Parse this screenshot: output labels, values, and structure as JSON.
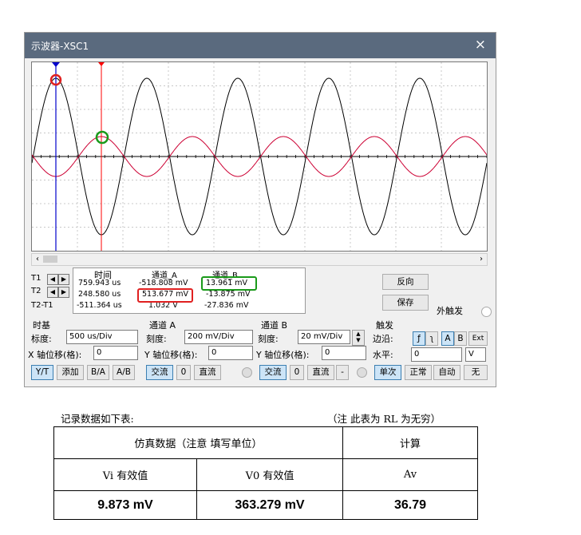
{
  "window": {
    "title": "示波器-XSC1",
    "close_label": "×"
  },
  "cursors": {
    "headers": {
      "time": "时间",
      "ch_a": "通道_A",
      "ch_b": "通道_B"
    },
    "rows": [
      {
        "label": "T1",
        "time": "759.943 us",
        "ch_a": "-518.808 mV",
        "ch_b": "13.961 mV"
      },
      {
        "label": "T2",
        "time": "248.580 us",
        "ch_a": "513.677 mV",
        "ch_b": "-13.875 mV"
      },
      {
        "label": "T2-T1",
        "time": "-511.364 us",
        "ch_a": "1.032 V",
        "ch_b": "-27.836 mV"
      }
    ],
    "left_arrow": "◀",
    "right_arrow": "▶"
  },
  "side_buttons": {
    "reverse": "反向",
    "save": "保存",
    "ext_trigger": "外触发"
  },
  "timebase": {
    "group": "时基",
    "scale_label": "标度:",
    "scale_value": "500 us/Div",
    "xpos_label": "X 轴位移(格):",
    "xpos_value": "0",
    "modes": [
      "Y/T",
      "添加",
      "B/A",
      "A/B"
    ]
  },
  "channel_a": {
    "group": "通道 A",
    "scale_label": "刻度:",
    "scale_value": "200 mV/Div",
    "ypos_label": "Y 轴位移(格):",
    "ypos_value": "0",
    "coupling": [
      "交流",
      "0",
      "直流"
    ]
  },
  "channel_b": {
    "group": "通道 B",
    "scale_label": "刻度:",
    "scale_value": "20 mV/Div",
    "ypos_label": "Y 轴位移(格):",
    "ypos_value": "0",
    "coupling": [
      "交流",
      "0",
      "直流",
      "-"
    ]
  },
  "trigger": {
    "group": "触发",
    "edge_label": "边沿:",
    "edge_buttons": [
      "ƒ",
      "ʅ",
      "A",
      "B",
      "Ext"
    ],
    "level_label": "水平:",
    "level_value": "0",
    "level_unit": "V",
    "modes": [
      "单次",
      "正常",
      "自动",
      "无"
    ]
  },
  "record": {
    "caption": "记录数据如下表:",
    "note": "（注  此表为 RL 为无穷）",
    "header_sim": "仿真数据（注意  填写单位）",
    "header_calc": "计算",
    "col_vi": "Vi 有效值",
    "col_vo": "V0 有效值",
    "col_av": "Av",
    "val_vi": "9.873 mV",
    "val_vo": "363.279 mV",
    "val_av": "36.79"
  },
  "colors": {
    "channel_a": "#000000",
    "channel_b": "#cc0033",
    "cursor_t1": "#0000cc",
    "cursor_t2": "#ff0000",
    "highlight_red": "#e02020",
    "highlight_green": "#1a9a1a"
  }
}
